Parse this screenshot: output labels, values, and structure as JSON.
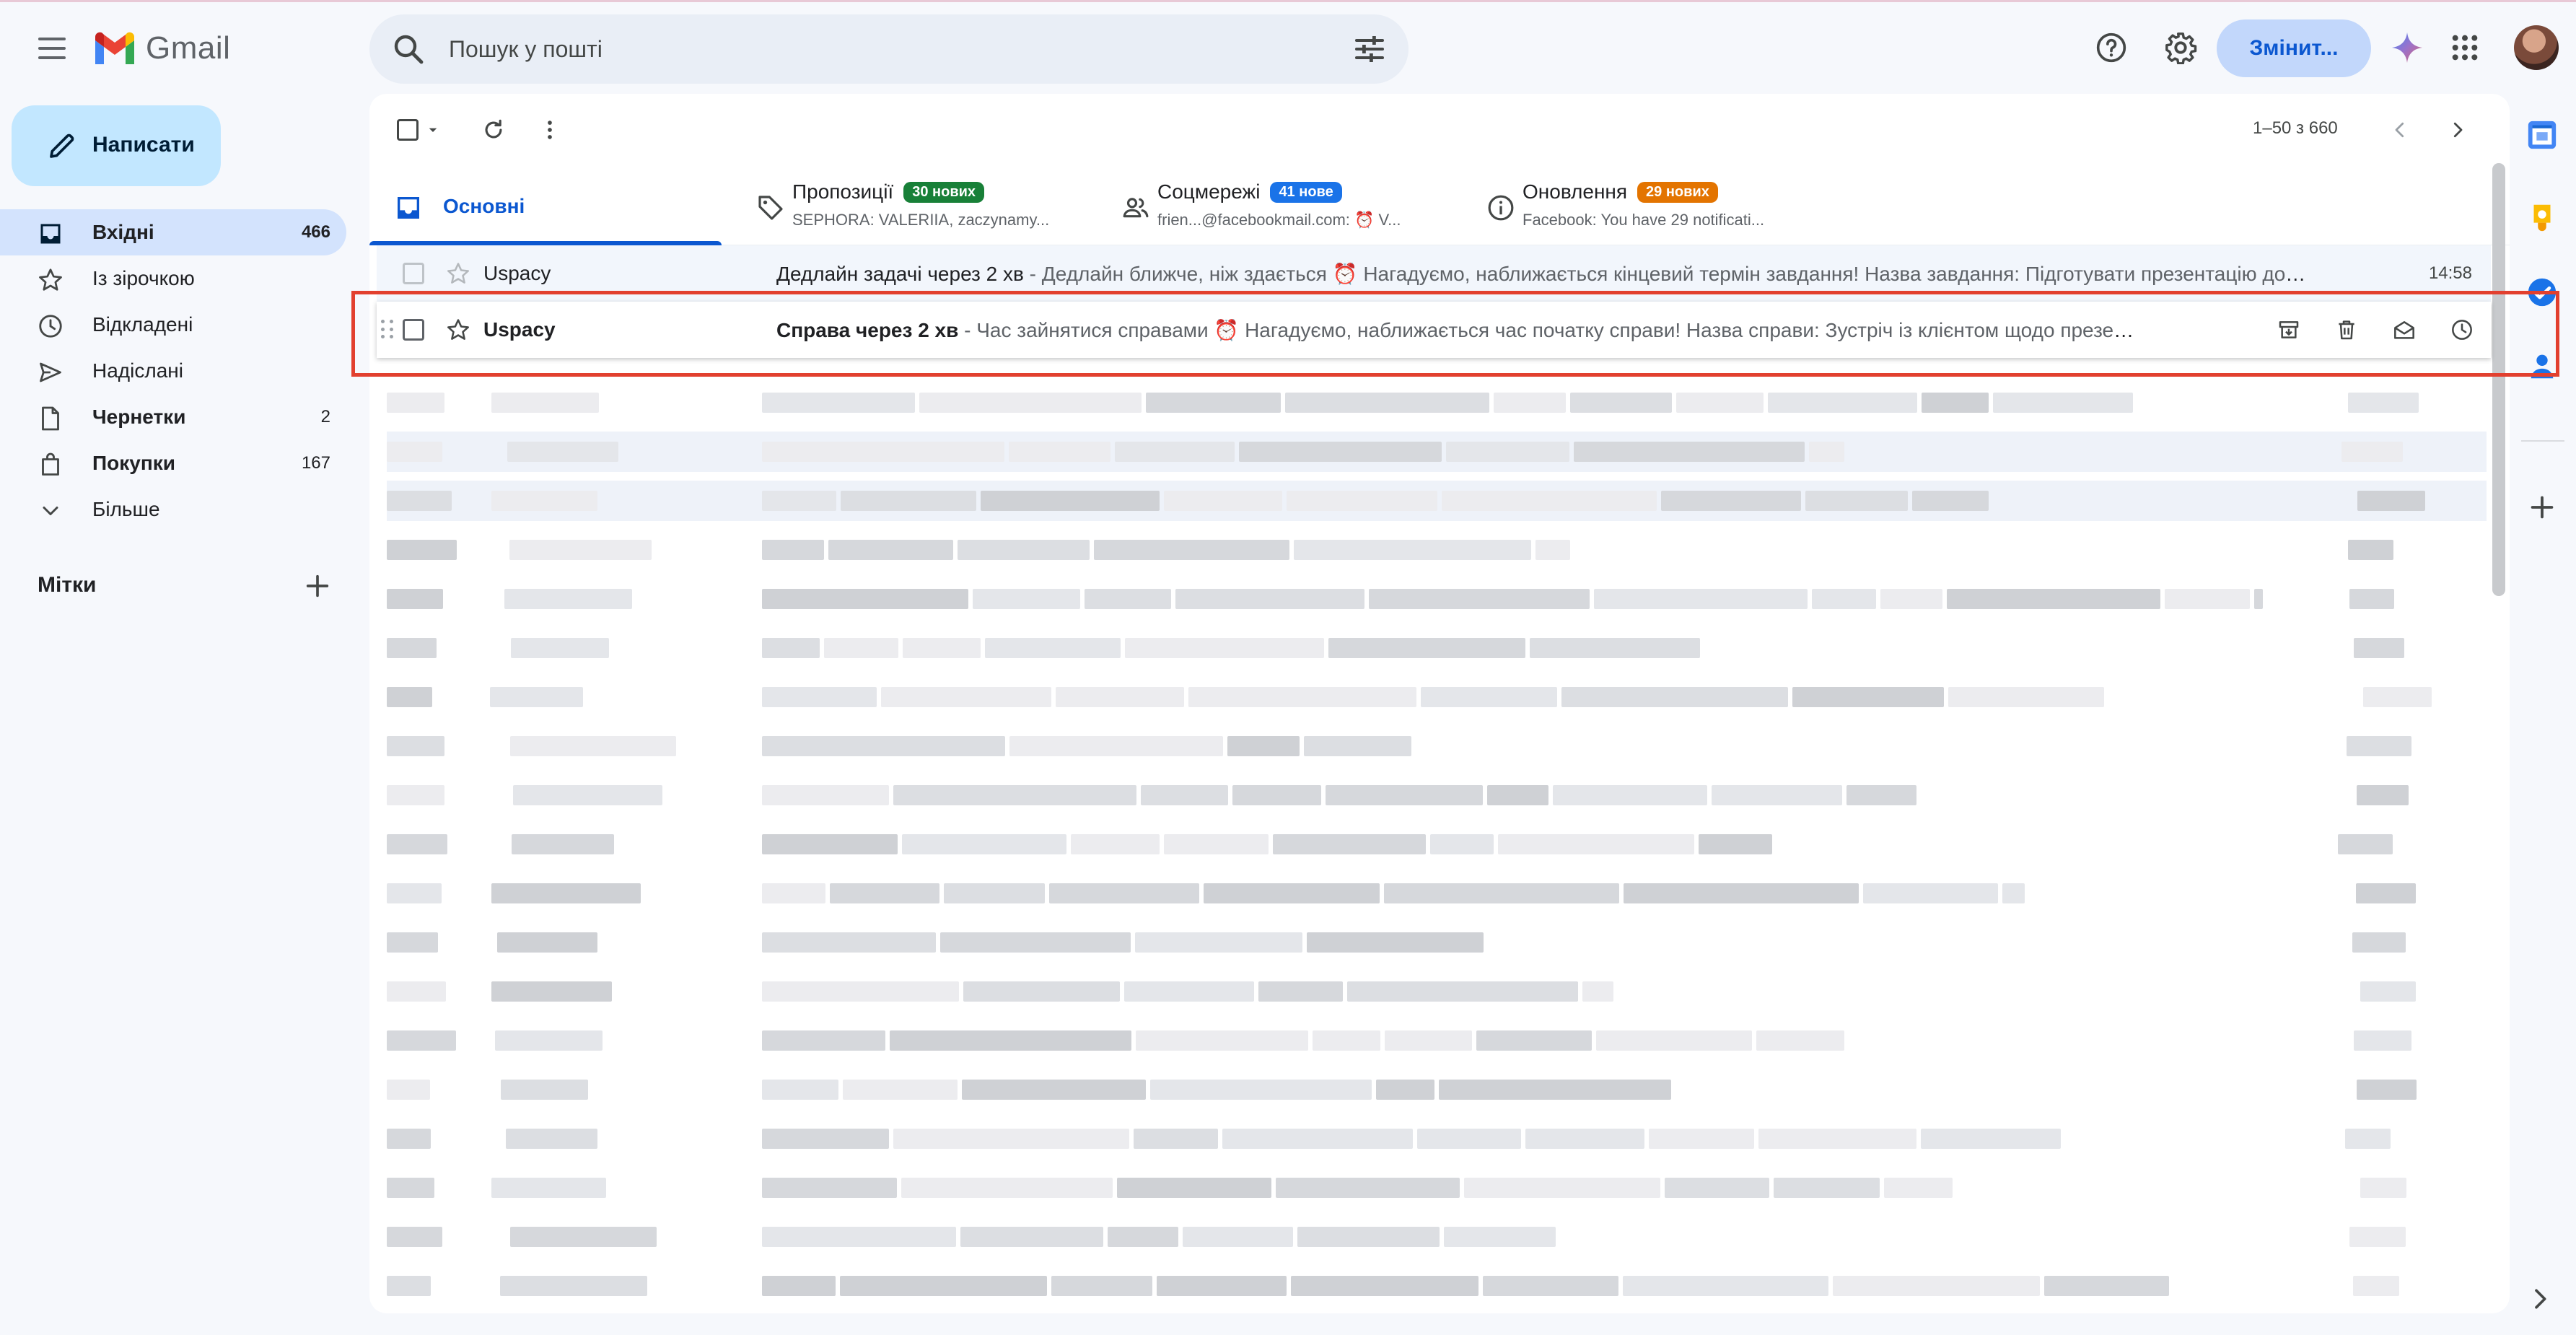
{
  "app": {
    "name": "Gmail",
    "brand_colors": {
      "red": "#ea4335",
      "blue": "#4285f4",
      "green": "#34a853",
      "yellow": "#fbbc04"
    }
  },
  "header": {
    "search_placeholder": "Пошук у пошті",
    "upgrade_label": "Змінит...",
    "icons": [
      "menu-icon",
      "search-icon",
      "search-options-icon",
      "help-icon",
      "settings-icon",
      "gemini-icon",
      "apps-icon",
      "avatar"
    ]
  },
  "sidebar": {
    "compose_label": "Написати",
    "items": [
      {
        "label": "Вхідні",
        "count": "466",
        "icon": "inbox-icon",
        "active": true,
        "bold": true
      },
      {
        "label": "Із зірочкою",
        "count": "",
        "icon": "star-icon",
        "active": false,
        "bold": false
      },
      {
        "label": "Відкладені",
        "count": "",
        "icon": "clock-icon",
        "active": false,
        "bold": false
      },
      {
        "label": "Надіслані",
        "count": "",
        "icon": "send-icon",
        "active": false,
        "bold": false
      },
      {
        "label": "Чернетки",
        "count": "2",
        "icon": "draft-icon",
        "active": false,
        "bold": true
      },
      {
        "label": "Покупки",
        "count": "167",
        "icon": "shopping-bag-icon",
        "active": false,
        "bold": true
      },
      {
        "label": "Більше",
        "count": "",
        "icon": "chevron-down-icon",
        "active": false,
        "bold": false
      }
    ],
    "labels_title": "Мітки"
  },
  "toolbar": {
    "pagination": "1–50 з 660"
  },
  "tabs": [
    {
      "title": "Основні",
      "badge": "",
      "subtitle": "",
      "icon": "inbox-icon"
    },
    {
      "title": "Пропозиції",
      "badge": "30 нових",
      "badge_color": "#188038",
      "subtitle": "SEPHORA: VALERIIA, zaczynamy...",
      "icon": "tag-icon"
    },
    {
      "title": "Соцмережі",
      "badge": "41 нове",
      "badge_color": "#1a73e8",
      "subtitle": "frien...@facebookmail.com: ⏰ V...",
      "icon": "people-icon"
    },
    {
      "title": "Оновлення",
      "badge": "29 нових",
      "badge_color": "#e37400",
      "subtitle": "Facebook: You have 29 notificati...",
      "icon": "info-icon"
    }
  ],
  "emails": [
    {
      "sender": "Uspacy",
      "subject": "Дедлайн задачі через 2 хв",
      "snippet": " - Дедлайн ближче, ніж здається ⏰ Нагадуємо, наближається кінцевий термін завдання! Назва завдання: Підготувати презентацію до ...",
      "time": "14:58",
      "read": true
    },
    {
      "sender": "Uspacy",
      "subject": "Справа через 2 хв",
      "snippet": " - Час зайнятися справами ⏰ Нагадуємо, наближається час початку справи! Назва справи: Зустріч із клієнтом щодо презентації пр...",
      "time": "",
      "read": false,
      "hover_actions": [
        "archive-icon",
        "delete-icon",
        "mark-read-icon",
        "snooze-icon"
      ]
    }
  ]
}
